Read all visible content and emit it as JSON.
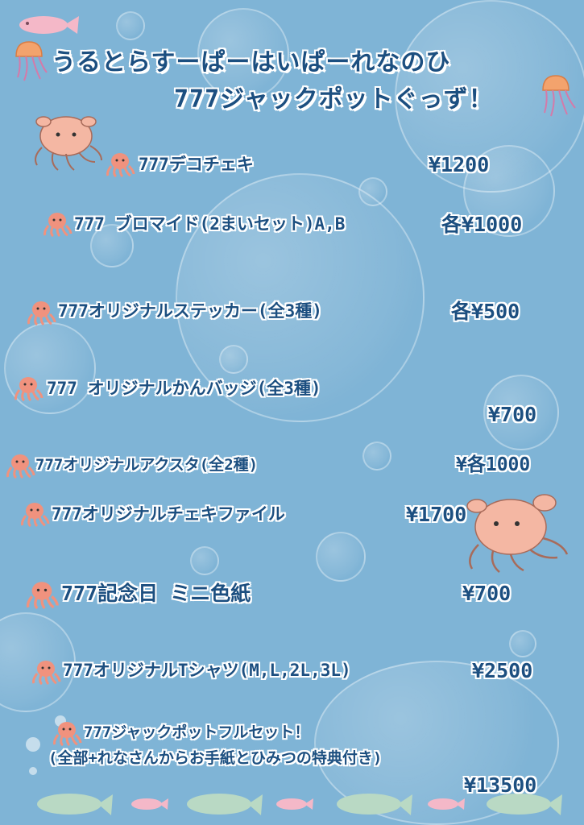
{
  "header": {
    "line1": "うるとらすーぱーはいぱーれなのひ",
    "line2": "777ジャックポットぐっず！"
  },
  "items": [
    {
      "label": "777デコチェキ",
      "price": "¥1200"
    },
    {
      "label": "777 ブロマイド(2まいセット)A,B",
      "price": "各¥1000"
    },
    {
      "label": "777オリジナルステッカー(全3種)",
      "price": "各¥500"
    },
    {
      "label": "777 オリジナルかんバッジ(全3種)",
      "price": "¥700"
    },
    {
      "label": "777オリジナルアクスタ(全2種)",
      "price": "¥各1000"
    },
    {
      "label": "777オリジナルチェキファイル",
      "price": "¥1700"
    },
    {
      "label": "777記念日 ミニ色紙",
      "price": "¥700"
    },
    {
      "label": "777オリジナルTシャツ(M,L,2L,3L)",
      "price": "¥2500"
    },
    {
      "label": "777ジャックポットフルセット！",
      "label2": "(全部+れなさんからお手紙とひみつの特典付き)",
      "price": "¥13500"
    }
  ],
  "colors": {
    "background": "#7fb4d6",
    "text": "#1c4f80",
    "octopus": "#f0927e",
    "dumbo": "#f4b7a3",
    "fish": "#b9d9c4",
    "pink_fish": "#f4b8c8"
  },
  "icons": [
    "jellyfish-icon",
    "octopus-icon",
    "dumbo-octopus-icon",
    "fish-icon"
  ]
}
